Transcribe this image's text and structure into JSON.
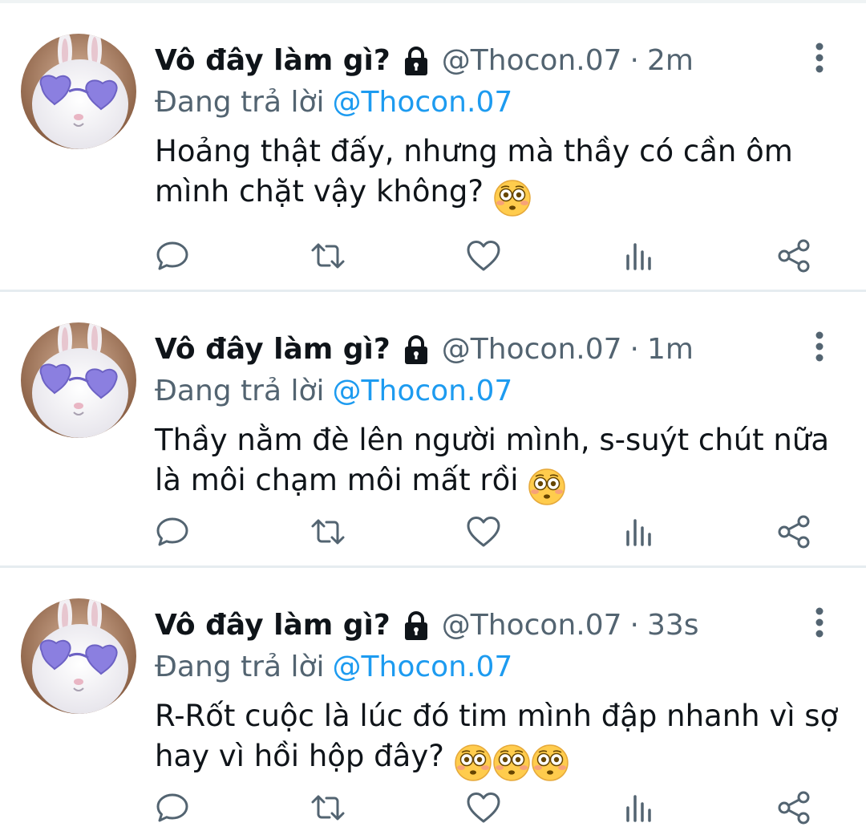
{
  "colors": {
    "text": "#0f1419",
    "secondary": "#536471",
    "link": "#1d9bf0",
    "divider": "#e6ecf0",
    "avatar_glasses": "#8b7fe0"
  },
  "icons": {
    "lock": "lock-icon",
    "more": "more-vertical-icon",
    "reply": "reply-icon",
    "retweet": "retweet-icon",
    "like": "heart-icon",
    "views": "views-icon",
    "share": "share-icon",
    "emoji": "flushed-face-emoji"
  },
  "tweets": [
    {
      "display_name": "Vô đây làm gì?",
      "handle": "@Thocon.07",
      "separator": "·",
      "time": "2m",
      "reply_prefix": "Đang trả lời",
      "reply_to": "@Thocon.07",
      "text": "Hoảng thật đấy, nhưng mà thầy có cần ôm mình chặt vậy không?",
      "emoji_count": 1
    },
    {
      "display_name": "Vô đây làm gì?",
      "handle": "@Thocon.07",
      "separator": "·",
      "time": "1m",
      "reply_prefix": "Đang trả lời",
      "reply_to": "@Thocon.07",
      "text": "Thầy nằm đè lên người mình, s-suýt chút nữa là môi chạm môi mất rồi",
      "emoji_count": 1
    },
    {
      "display_name": "Vô đây làm gì?",
      "handle": "@Thocon.07",
      "separator": "·",
      "time": "33s",
      "reply_prefix": "Đang trả lời",
      "reply_to": "@Thocon.07",
      "text": "R-Rốt cuộc là lúc đó tim mình đập nhanh vì sợ hay vì hồi hộp đây?",
      "emoji_count": 3
    }
  ]
}
